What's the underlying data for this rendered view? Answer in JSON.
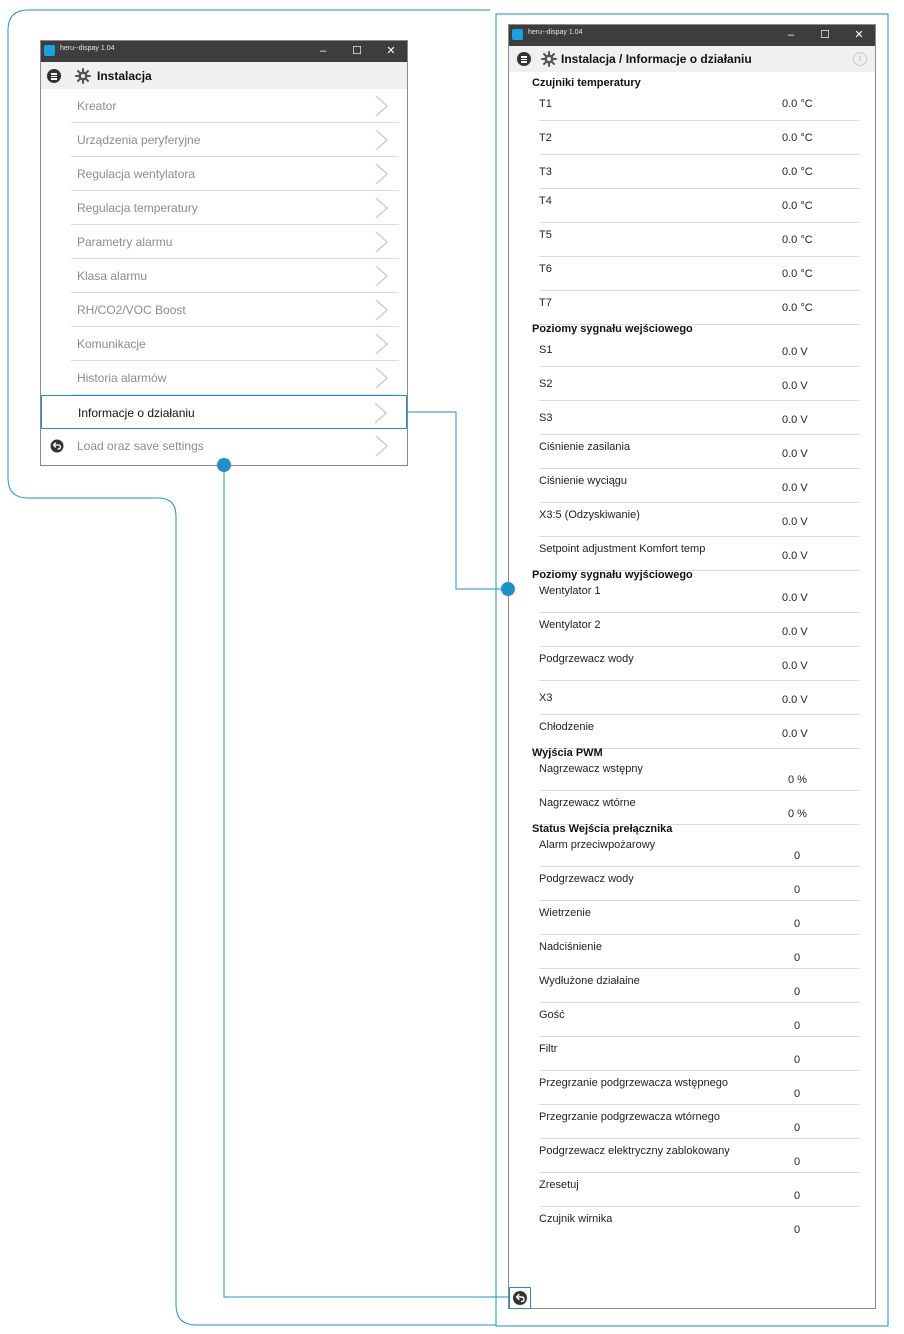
{
  "left_window": {
    "title": "heru--dispay 1.04",
    "header_title": "Instalacja",
    "items": [
      {
        "label": "Kreator",
        "active": false
      },
      {
        "label": "Urządzenia peryferyjne",
        "active": false
      },
      {
        "label": "Regulacja wentylatora",
        "active": false
      },
      {
        "label": "Regulacja temperatury",
        "active": false
      },
      {
        "label": "Parametry alarmu",
        "active": false
      },
      {
        "label": "Klasa alarmu",
        "active": false
      },
      {
        "label": "RH/CO2/VOC Boost",
        "active": false
      },
      {
        "label": "Komunikacje",
        "active": false
      },
      {
        "label": "Historia alarmów",
        "active": false
      },
      {
        "label": "Informacje o działaniu",
        "active": true
      },
      {
        "label": "Load oraz save settings",
        "active": false
      }
    ]
  },
  "right_window": {
    "title": "heru--dispay 1.04",
    "header_title": "Instalacja / Informacje o działaniu",
    "sections": [
      {
        "title": "Czujniki temperatury",
        "rows": [
          {
            "label": "T1",
            "value": "0.0 °C"
          },
          {
            "label": "T2",
            "value": "0.0 °C"
          },
          {
            "label": "T3",
            "value": "0.0 °C"
          },
          {
            "label": "T4",
            "value": "0.0 °C"
          },
          {
            "label": "T5",
            "value": "0.0 °C"
          },
          {
            "label": "T6",
            "value": "0.0 °C"
          },
          {
            "label": "T7",
            "value": "0.0 °C"
          }
        ]
      },
      {
        "title": "Poziomy sygnału wejściowego",
        "rows": [
          {
            "label": "S1",
            "value": "0.0 V"
          },
          {
            "label": "S2",
            "value": "0.0 V"
          },
          {
            "label": "S3",
            "value": "0.0 V"
          },
          {
            "label": "Ciśnienie zasilania",
            "value": "0.0 V"
          },
          {
            "label": "Ciśnienie wyciągu",
            "value": "0.0 V"
          },
          {
            "label": "X3:5 (Odzyskiwanie)",
            "value": "0.0 V"
          },
          {
            "label": "Setpoint adjustment Komfort temp",
            "value": "0.0 V"
          }
        ]
      },
      {
        "title": "Poziomy sygnału wyjściowego",
        "rows": [
          {
            "label": "Wentylator 1",
            "value": "0.0 V"
          },
          {
            "label": "Wentylator 2",
            "value": "0.0 V"
          },
          {
            "label": "Podgrzewacz wody",
            "value": "0.0 V"
          },
          {
            "label": "X3",
            "value": "0.0 V"
          },
          {
            "label": "Chłodzenie",
            "value": "0.0 V"
          }
        ]
      },
      {
        "title": "Wyjścia PWM",
        "rows": [
          {
            "label": "Nagrzewacz wstępny",
            "value": "0 %"
          },
          {
            "label": "Nagrzewacz wtórne",
            "value": "0 %"
          }
        ]
      },
      {
        "title": "Status Wejścia prełącznika",
        "rows": [
          {
            "label": "Alarm przeciwpożarowy",
            "value": "0"
          },
          {
            "label": "Podgrzewacz wody",
            "value": "0"
          },
          {
            "label": "Wietrzenie",
            "value": "0"
          },
          {
            "label": "Nadciśnienie",
            "value": "0"
          },
          {
            "label": "Wydłużone działaine",
            "value": "0"
          },
          {
            "label": "Gość",
            "value": "0"
          },
          {
            "label": "Filtr",
            "value": "0"
          },
          {
            "label": "Przegrzanie podgrzewacza wstępnego",
            "value": "0"
          },
          {
            "label": "Przegrzanie podgrzewacza wtórnego",
            "value": "0"
          },
          {
            "label": "Podgrzewacz elektryczny zablokowany",
            "value": "0"
          },
          {
            "label": "Zresetuj",
            "value": "0"
          },
          {
            "label": "Czujnik wirnika",
            "value": "0"
          }
        ]
      }
    ]
  },
  "colors": {
    "accent": "#1f90c8",
    "titlebar": "#3d3d3d",
    "header": "#f0f0f0",
    "app_icon": "#1ba1e2"
  }
}
